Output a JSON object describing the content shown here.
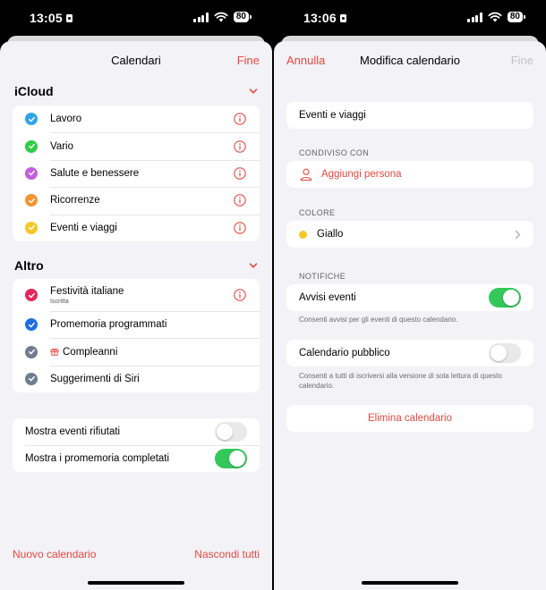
{
  "left": {
    "status": {
      "time": "13:05",
      "battery": "80"
    },
    "nav": {
      "title": "Calendari",
      "done": "Fine"
    },
    "icloud": {
      "title": "iCloud",
      "items": [
        {
          "label": "Lavoro",
          "color": "#2fa6e6"
        },
        {
          "label": "Vario",
          "color": "#2fcc45"
        },
        {
          "label": "Salute e benessere",
          "color": "#c35ddf"
        },
        {
          "label": "Ricorrenze",
          "color": "#f2952f"
        },
        {
          "label": "Eventi e viaggi",
          "color": "#f5c925"
        }
      ]
    },
    "altro": {
      "title": "Altro",
      "items": [
        {
          "label": "Festività italiane",
          "sub": "Iscritta",
          "color": "#e4285a"
        },
        {
          "label": "Promemoria programmati",
          "color": "#1e6fe6"
        },
        {
          "label": "Compleanni",
          "color": "#6f7e8f"
        },
        {
          "label": "Suggerimenti di Siri",
          "color": "#6f7e8f"
        }
      ]
    },
    "toggles": [
      {
        "label": "Mostra eventi rifiutati",
        "on": false
      },
      {
        "label": "Mostra i promemoria completati",
        "on": true
      }
    ],
    "footer": {
      "new_calendar": "Nuovo calendario",
      "hide_all": "Nascondi tutti"
    }
  },
  "right": {
    "status": {
      "time": "13:06",
      "battery": "80"
    },
    "nav": {
      "cancel": "Annulla",
      "title": "Modifica calendario",
      "done": "Fine"
    },
    "calendar_name": "Eventi e viaggi",
    "shared": {
      "caption": "CONDIVISO CON",
      "add_person": "Aggiungi persona"
    },
    "color": {
      "caption": "COLORE",
      "value": "Giallo",
      "swatch": "#f5c925"
    },
    "notifications": {
      "caption": "NOTIFICHE",
      "alerts_label": "Avvisi eventi",
      "alerts_on": true,
      "alerts_help": "Consenti avvisi per gli eventi di questo calendario."
    },
    "public": {
      "label": "Calendario pubblico",
      "on": false,
      "help": "Consenti a tutti di iscriversi alla versione di sola lettura di questo calendario."
    },
    "delete": "Elimina calendario"
  },
  "colors": {
    "accent": "#e8483f",
    "toggle_on": "#34c759"
  }
}
